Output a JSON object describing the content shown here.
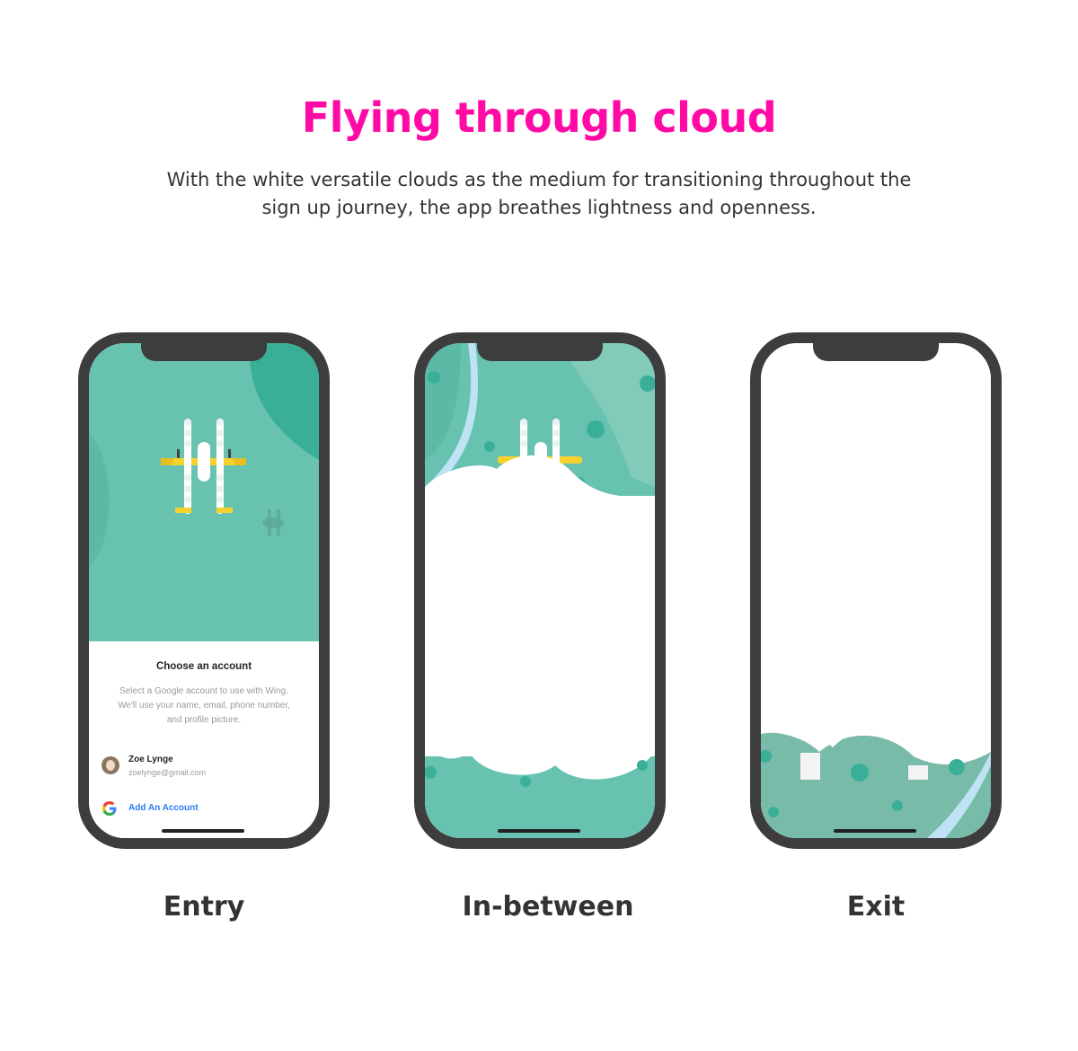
{
  "header": {
    "title": "Flying through cloud",
    "subtitle": "With the white versatile clouds as the medium for transitioning throughout the sign up journey, the app breathes lightness and openness."
  },
  "colors": {
    "accent": "#ff0aa5",
    "teal": "#68c2b0",
    "teal_dark": "#3aaf98",
    "phone_frame": "#3d3d3d",
    "wing_yellow": "#f5d22e",
    "link_blue": "#2a7bf6"
  },
  "phones": [
    {
      "caption": "Entry",
      "sheet": {
        "title": "Choose an account",
        "description": "Select a Google account to use with Wing. We'll use your name, email, phone number, and profile picture.",
        "account": {
          "name": "Zoe Lynge",
          "email": "zoelynge@gmail.com",
          "avatar_icon": "avatar-photo"
        },
        "add_account": {
          "label": "Add An Account",
          "icon": "google-g-icon"
        }
      }
    },
    {
      "caption": "In-between"
    },
    {
      "caption": "Exit"
    }
  ]
}
